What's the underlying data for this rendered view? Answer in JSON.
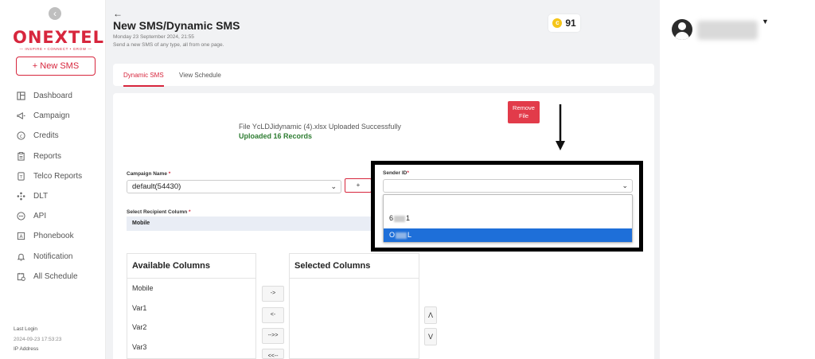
{
  "sidebar": {
    "collapse_icon": "chevron-left-icon",
    "logo_text": "ONEXTEL",
    "logo_tagline": "— INSPIRE • CONNECT • GROW —",
    "new_sms_label": "+ New SMS",
    "items": [
      {
        "label": "Dashboard",
        "icon": "dashboard-icon"
      },
      {
        "label": "Campaign",
        "icon": "megaphone-icon"
      },
      {
        "label": "Credits",
        "icon": "credits-icon"
      },
      {
        "label": "Reports",
        "icon": "reports-icon"
      },
      {
        "label": "Telco Reports",
        "icon": "telco-reports-icon"
      },
      {
        "label": "DLT",
        "icon": "dlt-icon"
      },
      {
        "label": "API",
        "icon": "api-icon"
      },
      {
        "label": "Phonebook",
        "icon": "phonebook-icon"
      },
      {
        "label": "Notification",
        "icon": "bell-icon"
      },
      {
        "label": "All Schedule",
        "icon": "schedule-icon"
      }
    ],
    "last_login_label": "Last Login",
    "last_login_value": "2024-09-23 17:53:23",
    "ip_label": "IP Address"
  },
  "header": {
    "back_icon": "back-arrow-icon",
    "title": "New SMS/Dynamic SMS",
    "date": "Monday 23 September 2024, 21:55",
    "description": "Send a new SMS of any type, all from one page.",
    "credits": "91"
  },
  "tabs": [
    {
      "label": "Dynamic SMS",
      "active": true
    },
    {
      "label": "View Schedule",
      "active": false
    }
  ],
  "upload": {
    "remove_label": "Remove File",
    "message": "File YcLDJidynamic (4).xlsx Uploaded Successfully",
    "count": "Uploaded 16 Records"
  },
  "form": {
    "campaign_label": "Campaign Name",
    "campaign_value": "default(54430)",
    "add_label": "+",
    "recipient_label": "Select Recipient Column",
    "recipient_value": "Mobile",
    "sender_label": "Sender ID",
    "sender_value": "",
    "required_mark": "*",
    "sender_options": [
      {
        "prefix": "6",
        "suffix": "1",
        "selected": false
      },
      {
        "prefix": "O",
        "suffix": "L",
        "selected": true
      }
    ]
  },
  "columns": {
    "available_title": "Available Columns",
    "available": [
      "Mobile",
      "Var1",
      "Var2",
      "Var3"
    ],
    "selected_title": "Selected Columns",
    "move_buttons": [
      "->",
      "<-",
      "-->>",
      "<<--"
    ],
    "order_buttons": [
      "Λ",
      "V"
    ]
  },
  "user": {
    "avatar_icon": "user-avatar-icon",
    "caret": "▼"
  },
  "colors": {
    "brand": "#d7263d",
    "success": "#2e7d32",
    "selected_option": "#1e6fd9"
  }
}
